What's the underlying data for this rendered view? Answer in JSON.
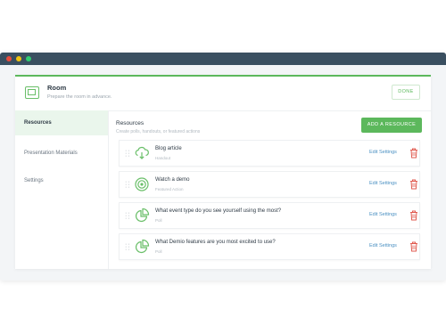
{
  "window": {
    "controls": [
      "close",
      "minimize",
      "maximize"
    ]
  },
  "header": {
    "title": "Room",
    "subtitle": "Prepare the room in advance.",
    "done_label": "DONE",
    "icon": "room-icon"
  },
  "sidebar": {
    "items": [
      {
        "label": "Resources",
        "active": true
      },
      {
        "label": "Presentation Materials",
        "active": false
      },
      {
        "label": "Settings",
        "active": false
      }
    ]
  },
  "main": {
    "title": "Resources",
    "subtitle": "Create polls, handouts, or featured actions",
    "add_label": "ADD A RESOURCE",
    "resources": [
      {
        "title": "Blog article",
        "type": "Handout",
        "icon": "cloud-download-icon",
        "edit_label": "Edit Settings"
      },
      {
        "title": "Watch a demo",
        "type": "Featured Action",
        "icon": "target-icon",
        "edit_label": "Edit Settings"
      },
      {
        "title": "What event type do you see yourself using the most?",
        "type": "Poll",
        "icon": "pie-chart-icon",
        "edit_label": "Edit Settings"
      },
      {
        "title": "What Demio features are you most excited to use?",
        "type": "Poll",
        "icon": "pie-chart-icon",
        "edit_label": "Edit Settings"
      }
    ]
  },
  "colors": {
    "accent": "#5cb85c",
    "titlebar": "#3a4f60",
    "link": "#4a90c2",
    "danger": "#e05a4f"
  }
}
